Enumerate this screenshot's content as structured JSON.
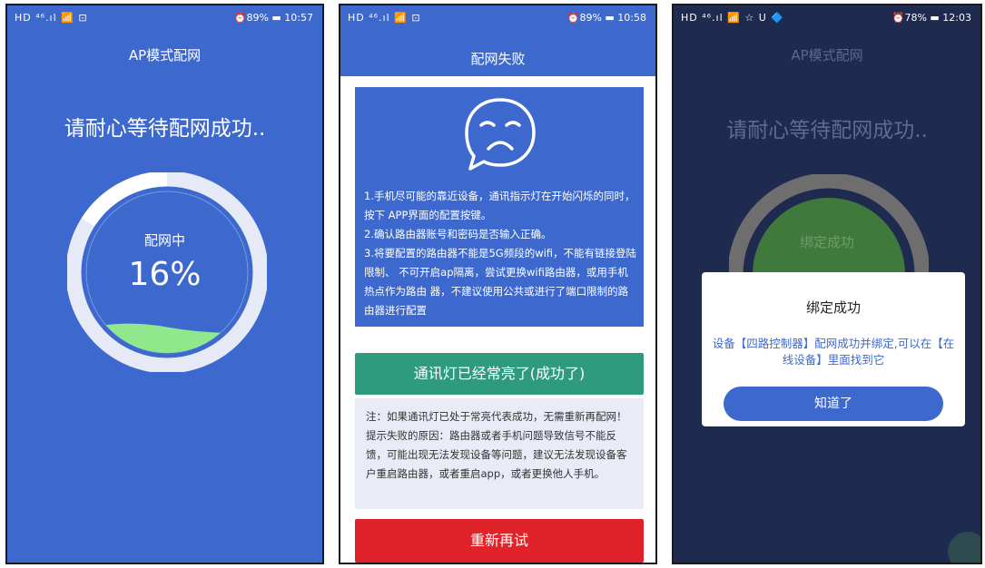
{
  "screen1": {
    "status": {
      "left": "HD ⁴⁶.ıl 📶 ⊡",
      "battery": "89%",
      "time": "10:57"
    },
    "title": "AP模式配网",
    "headline": "请耐心等待配网成功..",
    "ring_label": "配网中",
    "progress_text": "16%",
    "progress": 0.16,
    "colors": {
      "background": "#3d69cf",
      "wave": "#8fe98c"
    }
  },
  "screen2": {
    "status": {
      "left": "HD ⁴⁶.ıl 📶 ⊡",
      "battery": "89%",
      "time": "10:58"
    },
    "title": "配网失败",
    "tips": [
      "1.手机尽可能的靠近设备，通讯指示灯在开始闪烁的同时，按下 APP界面的配置按键。",
      "2.确认路由器账号和密码是否输入正确。",
      "3.将要配置的路由器不能是5G频段的wifi，不能有链接登陆限制、 不可开启ap隔离，尝试更换wifi路由器，或用手机热点作为路由 器，不建议使用公共或进行了端口限制的路由器进行配置"
    ],
    "success_button": "通讯灯已经常亮了(成功了)",
    "note": "注：如果通讯灯已处于常亮代表成功，无需重新再配网！ 提示失败的原因：路由器或者手机问题导致信号不能反馈，可能出现无法发现设备等问题，建议无法发现设备客户重启路由器，或者重启app，或者更换他人手机。",
    "retry_button": "重新再试",
    "colors": {
      "success": "#2e9a7e",
      "retry": "#e0222a"
    }
  },
  "screen3": {
    "status": {
      "left": "HD ⁴⁶.ıl 📶 ☆ U 🔷",
      "battery": "78%",
      "time": "12:03"
    },
    "title": "AP模式配网",
    "headline": "请耐心等待配网成功..",
    "bg_ring_label": "绑定成功",
    "dialog": {
      "title": "绑定成功",
      "message": "设备【四路控制器】配网成功并绑定,可以在【在线设备】里面找到它",
      "button": "知道了"
    }
  }
}
